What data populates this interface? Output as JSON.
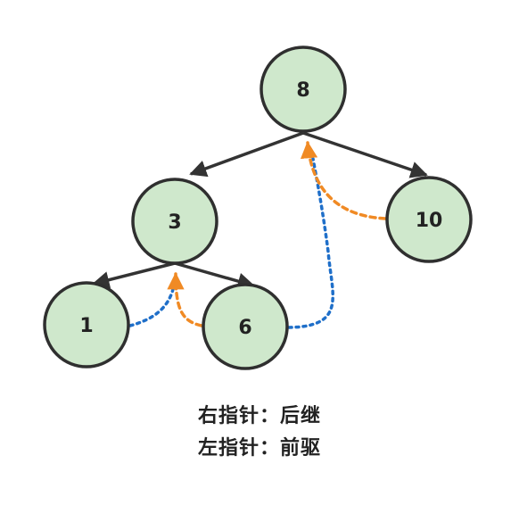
{
  "nodes": [
    {
      "id": "n8",
      "label": "8"
    },
    {
      "id": "n3",
      "label": "3"
    },
    {
      "id": "n10",
      "label": "10"
    },
    {
      "id": "n1",
      "label": "1"
    },
    {
      "id": "n6",
      "label": "6"
    }
  ],
  "legend": {
    "right_pointer": "右指针：后继",
    "left_pointer": "左指针：前驱"
  },
  "colors": {
    "node_fill": "#cfe8cc",
    "node_stroke": "#2f2f2f",
    "edge": "#333333",
    "successor_thread": "#1f6fc9",
    "predecessor_thread": "#f08a24"
  }
}
